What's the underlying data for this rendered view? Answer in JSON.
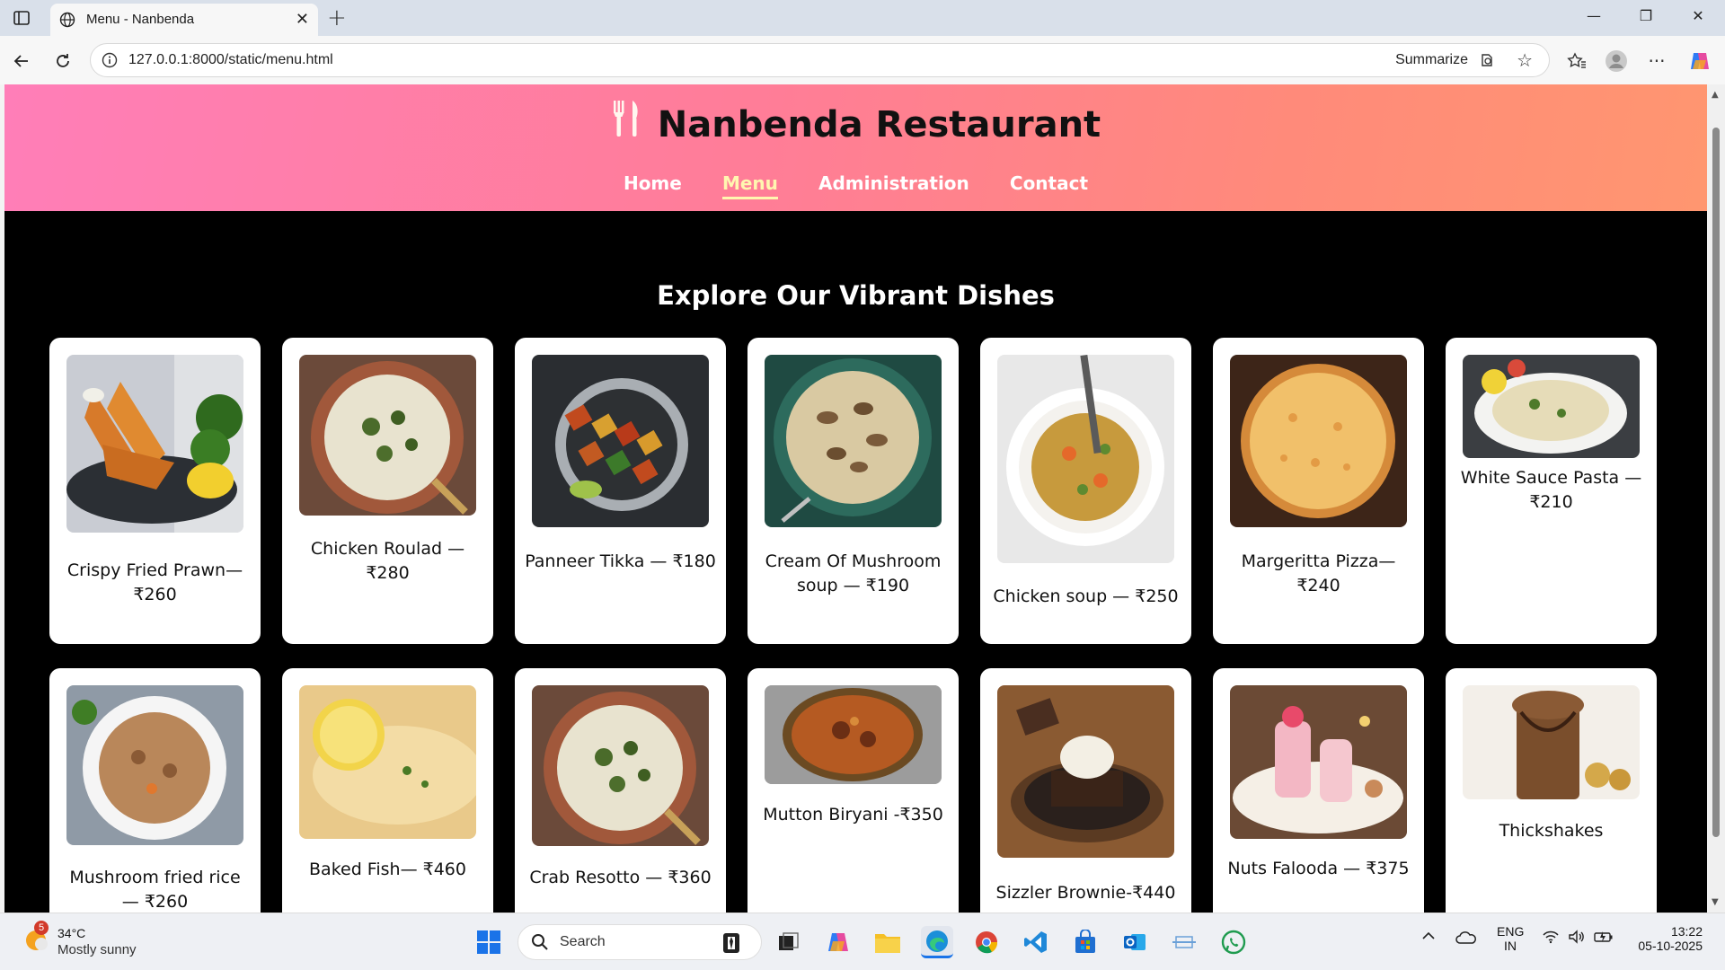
{
  "browser": {
    "tab_title": "Menu - Nanbenda",
    "url": "127.0.0.1:8000/static/menu.html",
    "summarize_label": "Summarize"
  },
  "site": {
    "brand": "Nanbenda Restaurant",
    "nav": [
      "Home",
      "Menu",
      "Administration",
      "Contact"
    ],
    "active_nav": "Menu",
    "section_title": "Explore Our Vibrant Dishes"
  },
  "dishes": [
    {
      "label": "Crispy Fried Prawn— ₹260",
      "image": "fried-prawn"
    },
    {
      "label": "Chicken Roulad — ₹280",
      "image": "risotto-bowl"
    },
    {
      "label": "Panneer Tikka — ₹180",
      "image": "paneer-tikka"
    },
    {
      "label": "Cream Of Mushroom soup — ₹190",
      "image": "mushroom-soup"
    },
    {
      "label": "Chicken soup — ₹250",
      "image": "chicken-soup"
    },
    {
      "label": "Margeritta Pizza— ₹240",
      "image": "pizza"
    },
    {
      "label": "White Sauce Pasta — ₹210",
      "image": "pasta"
    },
    {
      "label": "Mushroom fried rice — ₹260",
      "image": "fried-rice"
    },
    {
      "label": "Baked Fish— ₹460",
      "image": "baked-fish"
    },
    {
      "label": "Crab Resotto — ₹360",
      "image": "risotto-bowl"
    },
    {
      "label": "Mutton Biryani -₹350",
      "image": "biryani"
    },
    {
      "label": "Sizzler Brownie-₹440",
      "image": "brownie"
    },
    {
      "label": "Nuts Falooda — ₹375",
      "image": "falooda"
    },
    {
      "label": "Thickshakes",
      "image": "thickshake"
    }
  ],
  "taskbar": {
    "weather_badge": "5",
    "temperature": "34°C",
    "condition": "Mostly sunny",
    "search_placeholder": "Search",
    "lang_top": "ENG",
    "lang_bottom": "IN",
    "time": "13:22",
    "date": "05-10-2025"
  }
}
